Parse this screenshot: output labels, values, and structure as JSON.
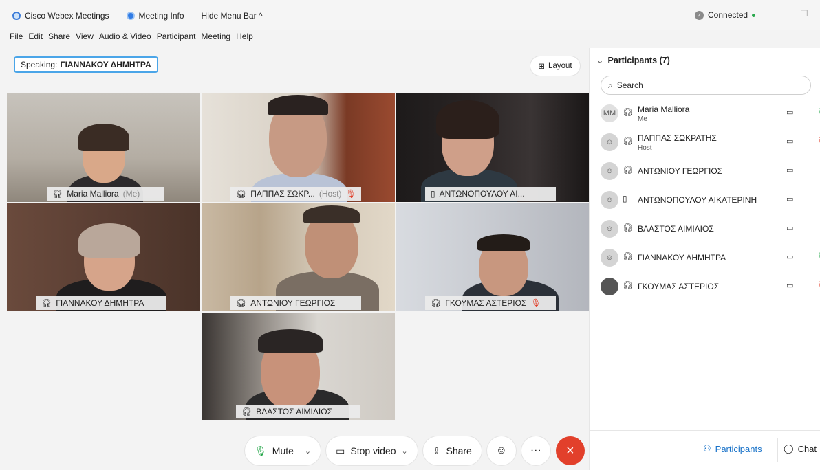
{
  "titlebar": {
    "app_name": "Cisco Webex Meetings",
    "meeting_info": "Meeting Info",
    "hide_menu": "Hide Menu Bar ^",
    "status": "Connected",
    "minimize": "—",
    "maximize": "☐"
  },
  "menu": [
    "File",
    "Edit",
    "Share",
    "View",
    "Audio & Video",
    "Participant",
    "Meeting",
    "Help"
  ],
  "speaking": {
    "label": "Speaking:",
    "name": "ΓΙΑΝΝΑΚΟΥ ΔΗΜΗΤΡΑ"
  },
  "layout_button": "Layout",
  "tiles": [
    {
      "name": "Maria Malliora",
      "suffix": "(Me)",
      "muted": false,
      "device": "headset"
    },
    {
      "name": "ΠΑΠΠΑΣ ΣΩΚΡ...",
      "suffix": "(Host)",
      "muted": true,
      "device": "headset"
    },
    {
      "name": "ΑΝΤΩΝΟΠΟΥΛΟΥ ΑΙ...",
      "suffix": "",
      "muted": false,
      "device": "phone"
    },
    {
      "name": "ΓΙΑΝΝΑΚΟΥ ΔΗΜΗΤΡΑ",
      "suffix": "",
      "muted": false,
      "device": "headset"
    },
    {
      "name": "ΑΝΤΩΝΙΟΥ ΓΕΩΡΓΙΟΣ",
      "suffix": "",
      "muted": false,
      "device": "headset"
    },
    {
      "name": "ΓΚΟΥΜΑΣ ΑΣΤΕΡΙΟΣ",
      "suffix": "",
      "muted": true,
      "device": "headset"
    },
    {
      "name": "ΒΛΑΣΤΟΣ ΑΙΜΙΛΙΟΣ",
      "suffix": "",
      "muted": false,
      "device": "headset"
    }
  ],
  "controls": {
    "mute": "Mute",
    "stop_video": "Stop video",
    "share": "Share",
    "more": "···",
    "end": "×"
  },
  "panel": {
    "title": "Participants (7)",
    "search_placeholder": "Search",
    "participants": [
      {
        "name": "Maria Malliora",
        "role": "Me",
        "avatar": "MM",
        "mic": "green"
      },
      {
        "name": "ΠΑΠΠΑΣ ΣΩΚΡΑΤΗΣ",
        "role": "Host",
        "avatar": "",
        "mic": "red"
      },
      {
        "name": "ΑΝΤΩΝΙΟΥ ΓΕΩΡΓΙΟΣ",
        "role": "",
        "avatar": "",
        "mic": ""
      },
      {
        "name": "ΑΝΤΩΝΟΠΟΥΛΟΥ ΑΙΚΑΤΕΡΙΝΗ",
        "role": "",
        "avatar": "",
        "mic": ""
      },
      {
        "name": "ΒΛΑΣΤΟΣ ΑΙΜΙΛΙΟΣ",
        "role": "",
        "avatar": "",
        "mic": ""
      },
      {
        "name": "ΓΙΑΝΝΑΚΟΥ ΔΗΜΗΤΡΑ",
        "role": "",
        "avatar": "",
        "mic": "green"
      },
      {
        "name": "ΓΚΟΥΜΑΣ ΑΣΤΕΡΙΟΣ",
        "role": "",
        "avatar": "",
        "mic": "red"
      }
    ],
    "bottom_participants": "Participants",
    "bottom_chat": "Chat"
  },
  "colors": {
    "accent": "#3fb1ea",
    "end_call": "#e2402b",
    "mic_green": "#29a84d",
    "link_blue": "#1a73c9"
  }
}
